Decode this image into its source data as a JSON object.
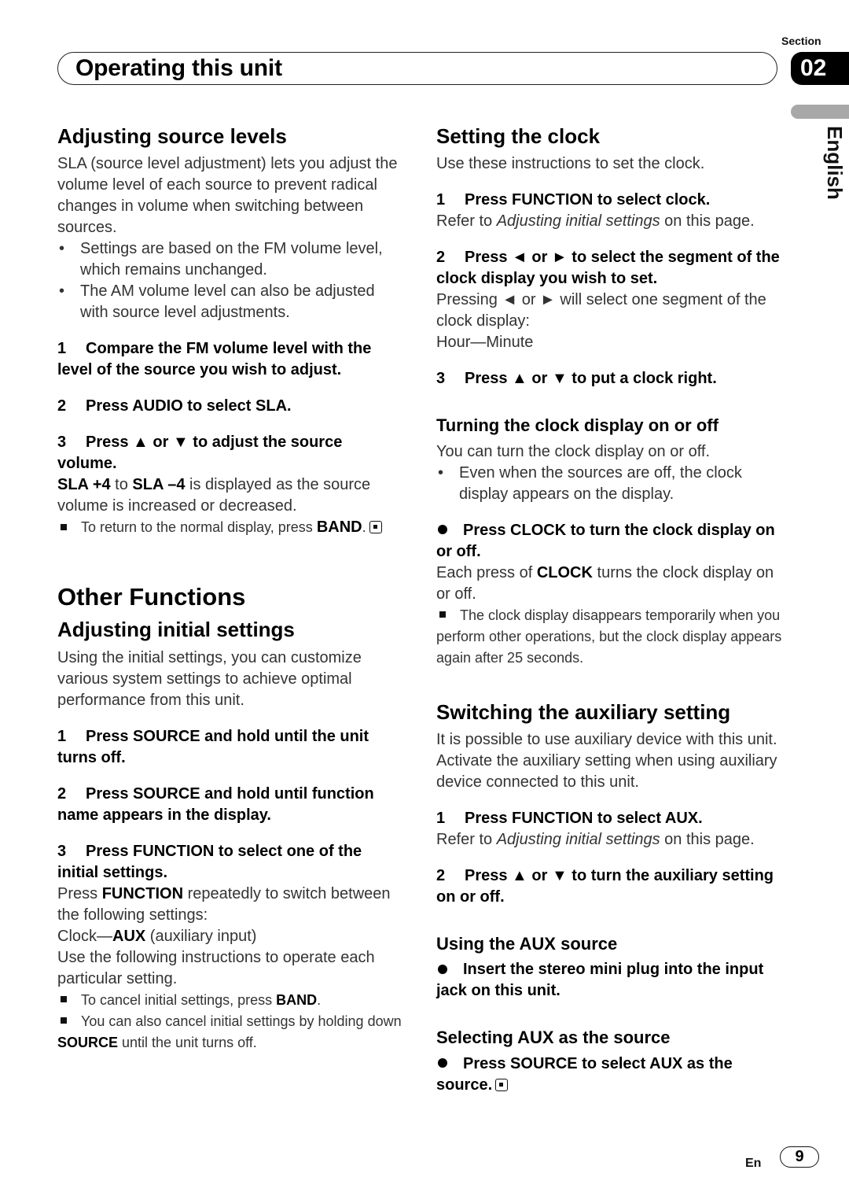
{
  "header": {
    "section_label": "Section",
    "title": "Operating this unit",
    "section_number": "02",
    "language": "English"
  },
  "left": {
    "sla": {
      "heading": "Adjusting source levels",
      "intro": "SLA (source level adjustment) lets you adjust the volume level of each source to prevent radical changes in volume when switching between sources.",
      "bullets": [
        "Settings are based on the FM volume level, which remains unchanged.",
        "The AM volume level can also be adjusted with source level adjustments."
      ],
      "steps": [
        {
          "num": "1",
          "text": "Compare the FM volume level with the level of the source you wish to adjust."
        },
        {
          "num": "2",
          "text": "Press AUDIO to select SLA."
        },
        {
          "num": "3",
          "text": "Press ▲ or ▼ to adjust the source volume."
        }
      ],
      "step3_desc": {
        "b1": "SLA +4",
        "t1": " to ",
        "b2": "SLA –4",
        "t2": " is displayed as the source volume is increased or decreased."
      },
      "note": {
        "text": "To return to the normal display, press ",
        "bold": "BAND",
        "end": "."
      }
    },
    "other": {
      "heading": "Other Functions",
      "sub_heading": "Adjusting initial settings",
      "intro": "Using the initial settings, you can customize various system settings to achieve optimal performance from this unit.",
      "steps": [
        {
          "num": "1",
          "text": "Press SOURCE and hold until the unit turns off."
        },
        {
          "num": "2",
          "text": "Press SOURCE and hold until function name appears in the display."
        },
        {
          "num": "3",
          "text": "Press FUNCTION to select one of the initial settings."
        }
      ],
      "step3_desc": {
        "t1": "Press ",
        "b1": "FUNCTION",
        "t2": " repeatedly to switch between the following settings:",
        "seq_t": "Clock—",
        "seq_b": "AUX",
        "seq_rest": " (auxiliary input)",
        "after": "Use the following instructions to operate each particular setting."
      },
      "notes": [
        {
          "text": "To cancel initial settings, press ",
          "bold": "BAND",
          "end": "."
        },
        {
          "text": "You can also cancel initial settings by holding down ",
          "bold": "SOURCE",
          "end": " until the unit turns off."
        }
      ]
    }
  },
  "right": {
    "clock": {
      "heading": "Setting the clock",
      "intro": "Use these instructions to set the clock.",
      "steps": [
        {
          "num": "1",
          "text": "Press FUNCTION to select clock."
        },
        {
          "num": "2",
          "text": "Press ◄ or ► to select the segment of the clock display you wish to set."
        },
        {
          "num": "3",
          "text": "Press ▲ or ▼ to put a clock right."
        }
      ],
      "step1_desc": {
        "t1": "Refer to ",
        "italic": "Adjusting initial settings",
        "t2": " on this page."
      },
      "step2_desc": "Pressing ◄ or ► will select one segment of the clock display:",
      "step2_seq": "Hour—Minute"
    },
    "clock_display": {
      "heading": "Turning the clock display on or off",
      "intro": "You can turn the clock display on or off.",
      "bullet": "Even when the sources are off, the clock display appears on the display.",
      "action": "Press CLOCK to turn the clock display on or off.",
      "desc": {
        "t1": "Each press of ",
        "b1": "CLOCK",
        "t2": " turns the clock display on or off."
      },
      "note": "The clock display disappears temporarily when you perform other operations, but the clock display appears again after 25 seconds."
    },
    "aux": {
      "heading": "Switching the auxiliary setting",
      "intro": "It is possible to use auxiliary device with this unit. Activate the auxiliary setting when using auxiliary device connected to this unit.",
      "steps": [
        {
          "num": "1",
          "text": "Press FUNCTION to select AUX."
        },
        {
          "num": "2",
          "text": "Press ▲ or ▼ to turn the auxiliary setting on or off."
        }
      ],
      "step1_desc": {
        "t1": "Refer to ",
        "italic": "Adjusting initial settings",
        "t2": " on this page."
      }
    },
    "aux_source": {
      "heading": "Using the AUX source",
      "action": "Insert the stereo mini plug into the input jack on this unit."
    },
    "select_aux": {
      "heading": "Selecting AUX as the source",
      "action": "Press SOURCE to select AUX as the source."
    }
  },
  "footer": {
    "lang_code": "En",
    "page_number": "9"
  }
}
